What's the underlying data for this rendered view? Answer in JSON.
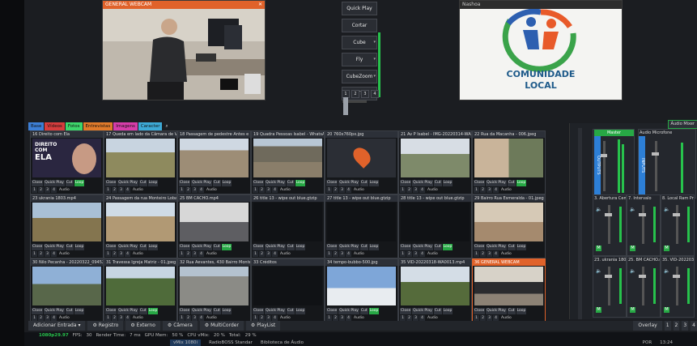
{
  "preview": {
    "title": "GENERAL WEBCAM"
  },
  "output": {
    "title": "Nashoa",
    "logo_text_line1": "COMUNIDADE",
    "logo_text_line2": "LOCAL"
  },
  "transitions": {
    "buttons": [
      "Quick Play",
      "Cortar",
      "Cube",
      "Fly",
      "CubeZoom",
      "FTB"
    ],
    "numbers": [
      "1",
      "2",
      "3",
      "4"
    ]
  },
  "tabs": [
    {
      "label": "Base",
      "color": "#3d7fd6"
    },
    {
      "label": "Vídeos",
      "color": "#d63d3d"
    },
    {
      "label": "Fotos",
      "color": "#3dd66b"
    },
    {
      "label": "Entrevistas",
      "color": "#e07a2a"
    },
    {
      "label": "Imagens",
      "color": "#d63da9"
    },
    {
      "label": "Caracter",
      "color": "#3da9d6"
    }
  ],
  "cell_controls": [
    "Close",
    "Quick Play",
    "Cut",
    "Loop"
  ],
  "cell_numbers": [
    "1",
    "2",
    "3",
    "4"
  ],
  "cell_audio_label": "Audio",
  "inputs": [
    {
      "num": "16",
      "name": "Direito com Ela"
    },
    {
      "num": "17",
      "name": "Queda em lado da Câmara de Vereador"
    },
    {
      "num": "18",
      "name": "Passagem de pedestre Antes e Depois"
    },
    {
      "num": "19",
      "name": "Quadra Pessoas Isabel - WhatsApp"
    },
    {
      "num": "20",
      "name": "760x760px.jpg"
    },
    {
      "num": "21",
      "name": "Av P Isabel - IMG-20220314-WA0005"
    },
    {
      "num": "22",
      "name": "Rua da Macanha - 006.jpeg"
    },
    {
      "num": "23",
      "name": "ukrania 1803.mp4"
    },
    {
      "num": "24",
      "name": "Passagem da rua Monteiro Lobato pe"
    },
    {
      "num": "25",
      "name": "BM CACHO.mp4"
    },
    {
      "num": "26",
      "name": "title 13 - wipe out blue.gtzip"
    },
    {
      "num": "27",
      "name": "title 13 - wipe out blue.gtzip"
    },
    {
      "num": "28",
      "name": "title 13 - wipe out blue.gtzip"
    },
    {
      "num": "29",
      "name": "Bairro Rua Esmeralda - 01.jpeg"
    },
    {
      "num": "30",
      "name": "Nilo Pecanha - 20220322_094527.jpg"
    },
    {
      "num": "31",
      "name": "Travessa Igreja Matriz - 01.jpeg"
    },
    {
      "num": "32",
      "name": "Rua Aevantes, 430 Bairro Monte Cele"
    },
    {
      "num": "33",
      "name": "Créditos"
    },
    {
      "num": "34",
      "name": "tempo-bubbo-500.jpg"
    },
    {
      "num": "35",
      "name": "VID-20220318-WA0013.mp4"
    },
    {
      "num": "36",
      "name": "GENERAL WEBCAM"
    }
  ],
  "thumb_texts": {
    "direito_line1": "DIREITO",
    "direito_line2": "COM",
    "direito_line3": "ELA"
  },
  "mixer": {
    "header_button": "Áudio Mixer",
    "master_label": "Master",
    "master_side": "OUTPUTS",
    "audio_mic_label": "Audio Microfone",
    "inputs_side": "INPUTS",
    "strips": [
      {
        "label": "3. Abertura Cemei"
      },
      {
        "label": "7. Intervalo"
      },
      {
        "label": "8. Local Ram Pray"
      },
      {
        "label": "23. ukrania 1803.mp"
      },
      {
        "label": "25. BM CACHO.mp"
      },
      {
        "label": "35. VID-20220318-"
      }
    ],
    "m_label": "M"
  },
  "bottombar": {
    "buttons": [
      "Adicionar Entrada",
      "Registro",
      "Externo",
      "Câmera",
      "MultiCorder",
      "PlayList"
    ],
    "overlay": "Overlay",
    "overlay_nums": [
      "1",
      "2",
      "3",
      "4"
    ]
  },
  "status": {
    "resolution": "1080p29.97",
    "fps_label": "FPS:",
    "fps": "30",
    "render_label": "Render Time:",
    "render": "7 ms",
    "gpu_label": "GPU Mem:",
    "gpu": "50 %",
    "cpu_label": "CPU vMix:",
    "cpu": "20 %",
    "total_label": "Total:",
    "total": "29 %"
  },
  "taskbar": {
    "items": [
      "vMix 1080i",
      "RadioBOSS Standar",
      "Biblioteca de Áudio"
    ],
    "lang": "POR",
    "time": "13:24"
  },
  "colors": {
    "accent_orange": "#e0622a",
    "green": "#27a845",
    "blue": "#2d7fd6"
  }
}
